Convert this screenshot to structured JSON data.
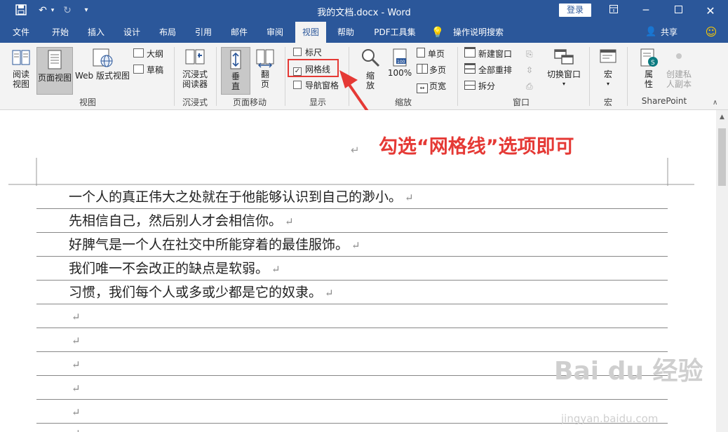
{
  "window": {
    "title": "我的文档.docx - Word",
    "login_label": "登录",
    "controls": [
      "restore-ribbon",
      "minimize",
      "maximize",
      "close"
    ]
  },
  "tabs": [
    {
      "label": "文件"
    },
    {
      "label": "开始"
    },
    {
      "label": "插入"
    },
    {
      "label": "设计"
    },
    {
      "label": "布局"
    },
    {
      "label": "引用"
    },
    {
      "label": "邮件"
    },
    {
      "label": "审阅"
    },
    {
      "label": "视图",
      "active": true
    },
    {
      "label": "帮助"
    },
    {
      "label": "PDF工具集"
    },
    {
      "label": "操作说明搜索"
    }
  ],
  "share_label": "共享",
  "ribbon": {
    "views_group": {
      "label": "视图",
      "read_mode": "阅读\n视图",
      "read_mode_l1": "阅读",
      "read_mode_l2": "视图",
      "print_layout": "页面视图",
      "web_layout": "Web 版式视图",
      "outline": "大纲",
      "draft": "草稿"
    },
    "immersive_group": {
      "label": "沉浸式",
      "reader_l1": "沉浸式",
      "reader_l2": "阅读器"
    },
    "page_move_group": {
      "label": "页面移动",
      "vertical_l1": "垂",
      "vertical_l2": "直",
      "side_l1": "翻",
      "side_l2": "页"
    },
    "show_group": {
      "label": "显示",
      "ruler": "标尺",
      "ruler_checked": false,
      "gridlines": "网格线",
      "gridlines_checked": true,
      "nav_pane": "导航窗格",
      "nav_pane_checked": false
    },
    "zoom_group": {
      "label": "缩放",
      "zoom_l1": "缩",
      "zoom_l2": "放",
      "hundred": "100%",
      "one_page": "单页",
      "multi_page": "多页",
      "page_width": "页宽"
    },
    "window_group": {
      "label": "窗口",
      "new_window": "新建窗口",
      "arrange_all": "全部重排",
      "split": "拆分",
      "switch_l1": "切换窗口"
    },
    "macros_group": {
      "label": "宏",
      "macros": "宏"
    },
    "sharepoint_group": {
      "label": "SharePoint",
      "properties_l1": "属",
      "properties_l2": "性",
      "private_l1": "创建私",
      "private_l2": "人副本"
    }
  },
  "document": {
    "lines": [
      "一个人的真正伟大之处就在于他能够认识到自己的渺小。",
      "先相信自己，然后别人才会相信你。",
      "好脾气是一个人在社交中所能穿着的最佳服饰。",
      "我们唯一不会改正的缺点是软弱。",
      "习惯，我们每个人或多或少都是它的奴隶。"
    ],
    "para_mark": "↵"
  },
  "annotation": "勾选“网格线”选项即可",
  "watermark": {
    "logo": "Bai du 经验",
    "url": "jingyan.baidu.com"
  },
  "colors": {
    "title_bar": "#2b579a",
    "annotation": "#e53935"
  }
}
